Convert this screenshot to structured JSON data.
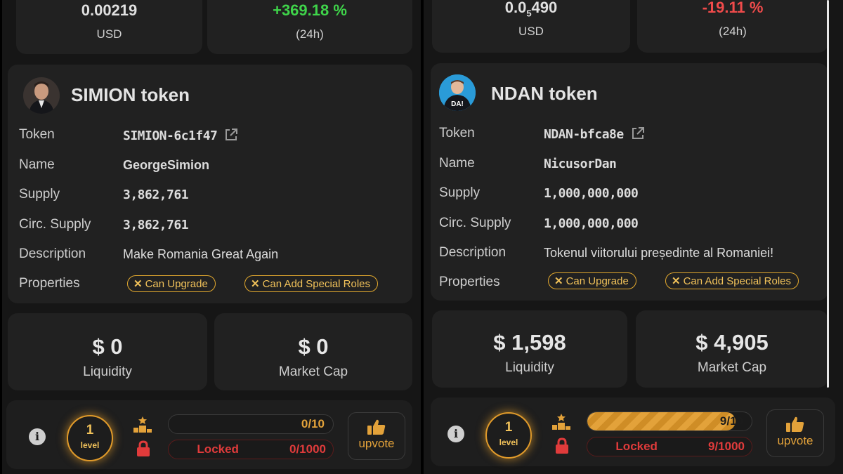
{
  "panels": [
    {
      "price": {
        "value": "0.00219",
        "unit": "USD"
      },
      "change": {
        "value": "+369.18 %",
        "period": "(24h)"
      },
      "token": {
        "title": "SIMION token",
        "rows": {
          "token": {
            "label": "Token",
            "value": "SIMION-6c1f47"
          },
          "name": {
            "label": "Name",
            "value": "GeorgeSimion"
          },
          "supply": {
            "label": "Supply",
            "value": "3,862,761"
          },
          "circ": {
            "label": "Circ. Supply",
            "value": "3,862,761"
          },
          "description": {
            "label": "Description",
            "value": "Make Romania Great Again"
          },
          "properties": {
            "label": "Properties",
            "badges": [
              "Can Upgrade",
              "Can Add Special Roles"
            ]
          }
        }
      },
      "liquidity": {
        "value": "$ 0",
        "label": "Liquidity"
      },
      "market_cap": {
        "value": "$ 0",
        "label": "Market Cap"
      },
      "footer": {
        "level_num": "1",
        "level_word": "level",
        "progress_text": "0/10",
        "progress_fraction": 0.0,
        "locked_label": "Locked",
        "locked_count": "0/1000",
        "upvote_label": "upvote"
      }
    },
    {
      "price": {
        "value_main": "0.0",
        "value_sub": "5",
        "value_tail": "490",
        "unit": "USD"
      },
      "change": {
        "value": "-19.11 %",
        "period": "(24h)"
      },
      "token": {
        "title": "NDAN token",
        "rows": {
          "token": {
            "label": "Token",
            "value": "NDAN-bfca8e"
          },
          "name": {
            "label": "Name",
            "value": "NicusorDan"
          },
          "supply": {
            "label": "Supply",
            "value": "1,000,000,000"
          },
          "circ": {
            "label": "Circ. Supply",
            "value": "1,000,000,000"
          },
          "description": {
            "label": "Description",
            "value": "Tokenul viitorului președinte al Romaniei!"
          },
          "properties": {
            "label": "Properties",
            "badges": [
              "Can Upgrade",
              "Can Add Special Roles"
            ]
          }
        }
      },
      "liquidity": {
        "value": "$ 1,598",
        "label": "Liquidity"
      },
      "market_cap": {
        "value": "$ 4,905",
        "label": "Market Cap"
      },
      "footer": {
        "level_num": "1",
        "level_word": "level",
        "progress_text": "9/10",
        "progress_fraction": 0.9,
        "locked_label": "Locked",
        "locked_count": "9/1000",
        "upvote_label": "upvote"
      }
    }
  ],
  "colors": {
    "accent": "#e3a23a",
    "positive": "#3fd44a",
    "negative": "#f04b4b",
    "locked": "#e03b3b",
    "card": "#212121"
  },
  "avatar_badge_text": "DA!"
}
